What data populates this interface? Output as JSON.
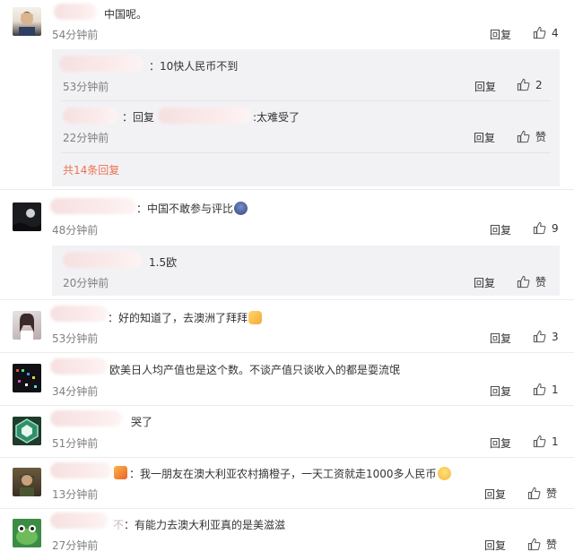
{
  "ui": {
    "reply_label": "回复",
    "like_zero_label": "赞"
  },
  "comments": [
    {
      "text": "中国呢。",
      "time": "54分钟前",
      "likes": "4",
      "more_label": "共14条回复",
      "replies": [
        {
          "text": "：10快人民币不到",
          "time": "53分钟前",
          "likes": "2"
        },
        {
          "text_pre": "：回复",
          "text_post": ":太难受了",
          "time": "22分钟前",
          "likes": "赞"
        }
      ]
    },
    {
      "text": "：中国不敢参与评比",
      "time": "48分钟前",
      "likes": "9",
      "replies": [
        {
          "text": "1.5欧",
          "time": "20分钟前",
          "likes": "赞"
        }
      ]
    },
    {
      "text": "：好的知道了，去澳洲了拜拜",
      "time": "53分钟前",
      "likes": "3"
    },
    {
      "text": "欧美日人均产值也是这个数。不谈产值只谈收入的都是耍流氓",
      "time": "34分钟前",
      "likes": "1"
    },
    {
      "text": "哭了",
      "time": "51分钟前",
      "likes": "1"
    },
    {
      "text": "：我一朋友在澳大利亚农村摘橙子，一天工资就走1000多人民币",
      "time": "13分钟前",
      "likes": "赞"
    },
    {
      "text_pre": "不",
      "text": "：有能力去澳大利亚真的是美滋滋",
      "time": "27分钟前",
      "likes": "赞"
    }
  ]
}
